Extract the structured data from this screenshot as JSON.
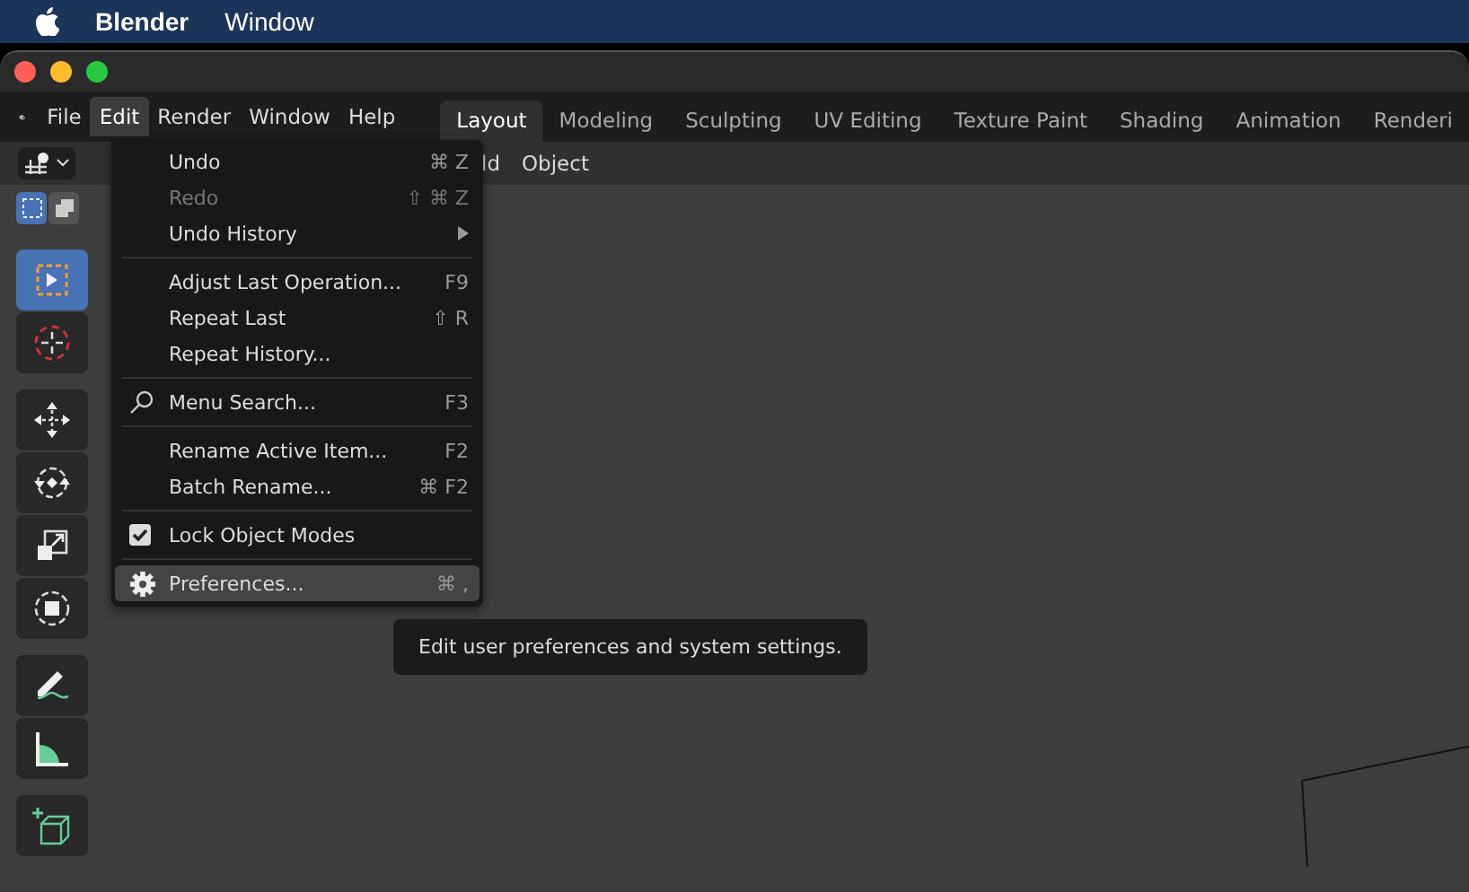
{
  "mac_menubar": {
    "app": "Blender",
    "items": [
      "Window"
    ]
  },
  "menubar": {
    "items": [
      {
        "label": "File",
        "selected": false
      },
      {
        "label": "Edit",
        "selected": true
      },
      {
        "label": "Render",
        "selected": false
      },
      {
        "label": "Window",
        "selected": false
      },
      {
        "label": "Help",
        "selected": false
      }
    ]
  },
  "workspace_tabs": [
    {
      "label": "Layout",
      "selected": true
    },
    {
      "label": "Modeling",
      "selected": false
    },
    {
      "label": "Sculpting",
      "selected": false
    },
    {
      "label": "UV Editing",
      "selected": false
    },
    {
      "label": "Texture Paint",
      "selected": false
    },
    {
      "label": "Shading",
      "selected": false
    },
    {
      "label": "Animation",
      "selected": false
    },
    {
      "label": "Renderi",
      "selected": false
    }
  ],
  "header": {
    "menus": [
      "ld",
      "Object"
    ]
  },
  "toolbar": {
    "tools": [
      {
        "kind": "select",
        "selected": true
      },
      {
        "kind": "cursor",
        "selected": false
      },
      {
        "kind": "move",
        "selected": false
      },
      {
        "kind": "rotate",
        "selected": false
      },
      {
        "kind": "scale",
        "selected": false
      },
      {
        "kind": "transform",
        "selected": false
      },
      {
        "kind": "annotate",
        "selected": false
      },
      {
        "kind": "measure",
        "selected": false
      },
      {
        "kind": "add-cube",
        "selected": false
      }
    ]
  },
  "edit_menu": {
    "items": [
      {
        "kind": "item",
        "label": "Undo",
        "shortcut": "⌘ Z",
        "disabled": false,
        "selected": false
      },
      {
        "kind": "item",
        "label": "Redo",
        "shortcut": "⇧ ⌘ Z",
        "disabled": true,
        "selected": false
      },
      {
        "kind": "submenu",
        "label": "Undo History",
        "disabled": false,
        "selected": false
      },
      {
        "kind": "separator"
      },
      {
        "kind": "item",
        "label": "Adjust Last Operation...",
        "shortcut": "F9",
        "disabled": false,
        "selected": false
      },
      {
        "kind": "item",
        "label": "Repeat Last",
        "shortcut": "⇧ R",
        "disabled": false,
        "selected": false
      },
      {
        "kind": "item",
        "label": "Repeat History...",
        "disabled": false,
        "selected": false
      },
      {
        "kind": "separator"
      },
      {
        "kind": "search",
        "label": "Menu Search...",
        "shortcut": "F3",
        "disabled": false,
        "selected": false
      },
      {
        "kind": "separator"
      },
      {
        "kind": "item",
        "label": "Rename Active Item...",
        "shortcut": "F2",
        "disabled": false,
        "selected": false
      },
      {
        "kind": "item",
        "label": "Batch Rename...",
        "shortcut": "⌘ F2",
        "disabled": false,
        "selected": false
      },
      {
        "kind": "separator"
      },
      {
        "kind": "checkbox",
        "label": "Lock Object Modes",
        "checked": true,
        "disabled": false,
        "selected": false
      },
      {
        "kind": "separator"
      },
      {
        "kind": "settings",
        "label": "Preferences...",
        "shortcut": "⌘ ,",
        "disabled": false,
        "selected": true
      }
    ]
  },
  "tooltip": {
    "text": "Edit user preferences and system settings."
  }
}
